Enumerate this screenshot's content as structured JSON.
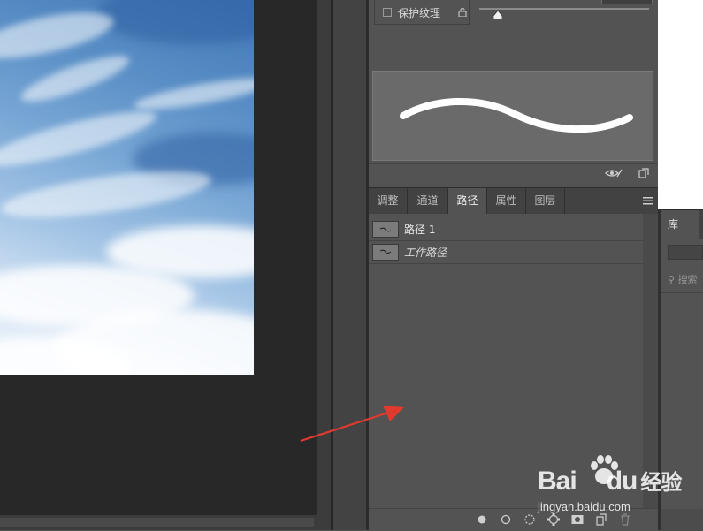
{
  "brush_panel": {
    "protect_texture_label": "保护纹理"
  },
  "tabs": [
    {
      "label": "调整"
    },
    {
      "label": "通道"
    },
    {
      "label": "路径",
      "active": true
    },
    {
      "label": "属性"
    },
    {
      "label": "图层"
    }
  ],
  "paths": [
    {
      "name": "路径 1",
      "italic": false
    },
    {
      "name": "工作路径",
      "italic": true
    }
  ],
  "library": {
    "tab_label": "库",
    "search_placeholder": "搜索"
  },
  "watermark": {
    "brand": "Bai",
    "brand_suffix": "du",
    "product": "经验",
    "url": "jingyan.baidu.com"
  },
  "colors": {
    "panel_bg": "#535353",
    "canvas_bg": "#282828",
    "annotation_arrow": "#e03a2f"
  }
}
